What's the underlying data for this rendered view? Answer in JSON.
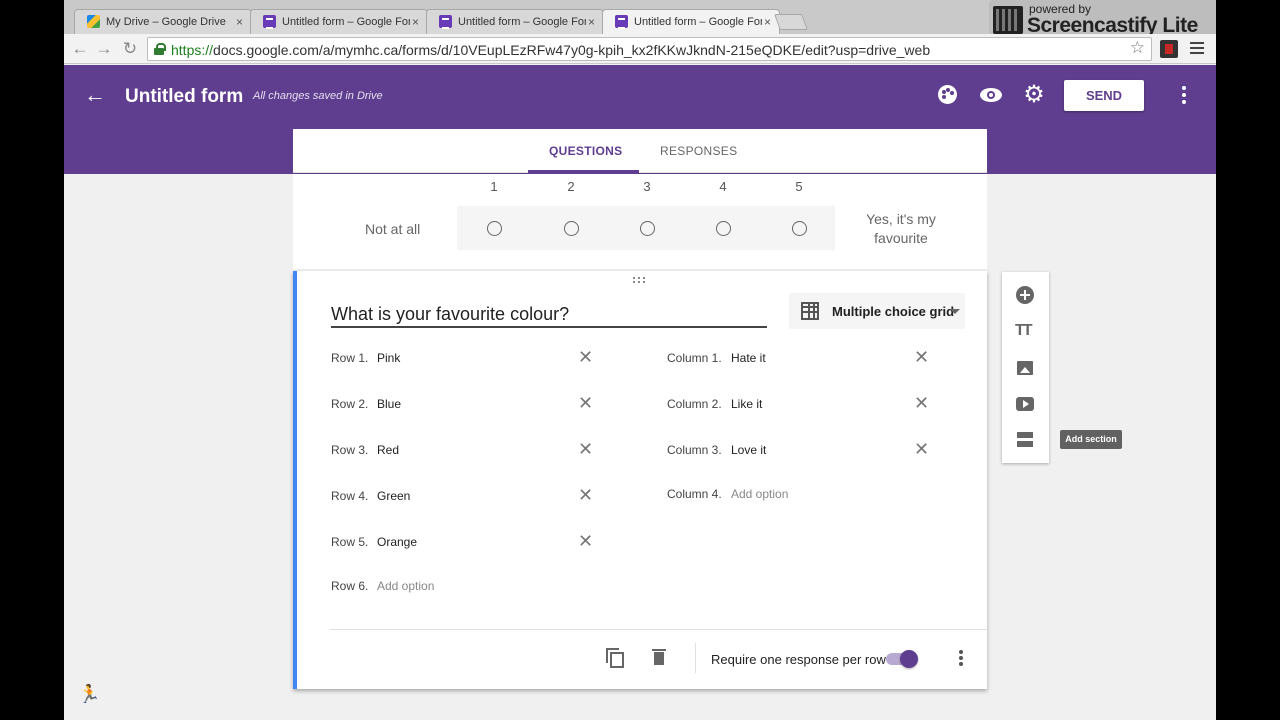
{
  "browser": {
    "tabs": [
      {
        "title": "My Drive – Google Drive",
        "icon": "google-drive-icon",
        "active": false
      },
      {
        "title": "Untitled form – Google Forms",
        "icon": "google-forms-icon",
        "active": false
      },
      {
        "title": "Untitled form – Google Forms",
        "icon": "google-forms-icon",
        "active": false
      },
      {
        "title": "Untitled form – Google Forms",
        "icon": "google-forms-icon",
        "active": true
      }
    ],
    "tab_close": "×",
    "url_scheme": "https://",
    "url_rest": "docs.google.com/a/mymhc.ca/forms/d/10VEupLEzRFw47y0g-kpih_kx2fKKwJkndN-215eQDKE/edit?usp=drive_web",
    "nav": {
      "back": "←",
      "forward": "→",
      "reload": "↻"
    },
    "star": "☆"
  },
  "screencastify": {
    "powered": "powered by",
    "name": "Screencastify Lite"
  },
  "header": {
    "back": "←",
    "title": "Untitled form",
    "save_status": "All changes saved in Drive",
    "send_label": "SEND",
    "gear": "⚙",
    "accent_color": "#5f3d8f"
  },
  "form_tabs": {
    "questions": "QUESTIONS",
    "responses": "RESPONSES"
  },
  "previous_question": {
    "scale_numbers": [
      "1",
      "2",
      "3",
      "4",
      "5"
    ],
    "low_label": "Not at all",
    "high_label": "Yes, it's my favourite"
  },
  "question": {
    "title": "What is your favourite colour?",
    "type": "Multiple choice grid",
    "rows": [
      {
        "label": "Row 1.",
        "value": "Pink"
      },
      {
        "label": "Row 2.",
        "value": "Blue"
      },
      {
        "label": "Row 3.",
        "value": "Red"
      },
      {
        "label": "Row 4.",
        "value": "Green"
      },
      {
        "label": "Row 5.",
        "value": "Orange"
      },
      {
        "label": "Row 6.",
        "value": "Add option",
        "placeholder": true
      }
    ],
    "columns": [
      {
        "label": "Column 1.",
        "value": "Hate it"
      },
      {
        "label": "Column 2.",
        "value": "Like it"
      },
      {
        "label": "Column 3.",
        "value": "Love it"
      },
      {
        "label": "Column 4.",
        "value": "Add option",
        "placeholder": true
      }
    ],
    "remove_glyph": "✕",
    "require_label": "Require one response per row",
    "require_on": true
  },
  "side_toolbar": {
    "title_glyph": "TT",
    "tooltip": "Add section"
  },
  "runner": "🏃"
}
